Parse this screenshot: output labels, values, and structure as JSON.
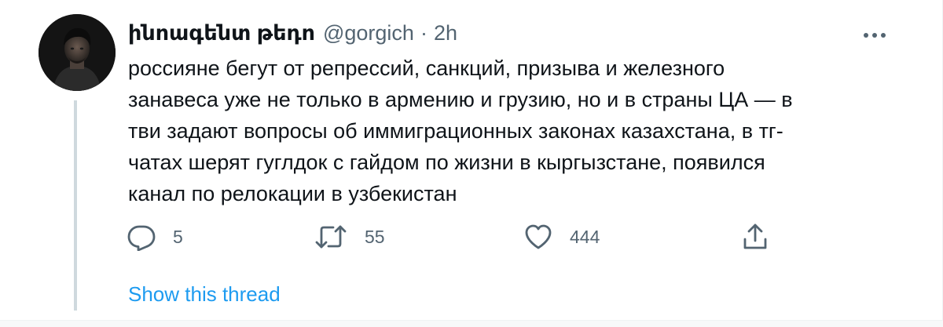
{
  "tweet": {
    "author": {
      "display_name": "ինոագենտ թեդո",
      "handle": "@gorgich",
      "separator": "·",
      "time": "2h"
    },
    "text_lines": [
      "россияне бегут от репрессий, санкций, призыва и железного",
      "занавеса уже не только в армению и грузию, но и в страны ЦА — в",
      "тви задают вопросы об иммиграционных законах казахстана, в тг-",
      "чатах шерят гуглдок с гайдом по жизни в кыргызстане, появился",
      "канал по релокации в узбекистан"
    ],
    "actions": {
      "reply": {
        "icon": "reply-icon",
        "count": "5"
      },
      "retweet": {
        "icon": "retweet-icon",
        "count": "55"
      },
      "like": {
        "icon": "heart-icon",
        "count": "444"
      },
      "share": {
        "icon": "share-icon"
      }
    },
    "more_icon": "more-icon",
    "show_thread_label": "Show this thread"
  },
  "colors": {
    "text_primary": "#0f1419",
    "text_secondary": "#536471",
    "link": "#1d9bf0",
    "thread_line": "#cfd9de"
  }
}
